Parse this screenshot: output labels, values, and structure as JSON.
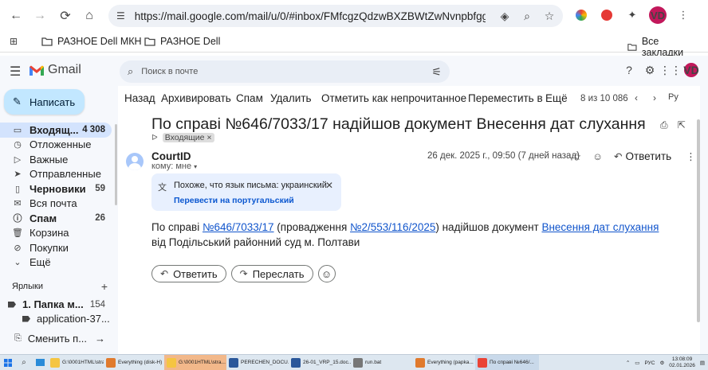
{
  "browser": {
    "url": "https://mail.google.com/mail/u/0/#inbox/FMfcgzQdzwBXZBWtZwNvnpbfggmxF...",
    "bookmarks": [
      "РАЗНОЕ Dell МКН",
      "РАЗНОЕ Dell"
    ],
    "all_bookmarks": "Все закладки",
    "profile_initials": "VD"
  },
  "gmail": {
    "logo_text": "Gmail",
    "search_placeholder": "Поиск в почте",
    "compose_label": "Написать",
    "nav": [
      {
        "label": "Входящ...",
        "count": "4 308",
        "icon": "inbox-icon"
      },
      {
        "label": "Отложенные",
        "count": "",
        "icon": "clock-icon"
      },
      {
        "label": "Важные",
        "count": "",
        "icon": "important-icon"
      },
      {
        "label": "Отправленные",
        "count": "",
        "icon": "send-icon"
      },
      {
        "label": "Черновики",
        "count": "59",
        "icon": "draft-icon"
      },
      {
        "label": "Вся почта",
        "count": "",
        "icon": "mail-icon"
      },
      {
        "label": "Спам",
        "count": "26",
        "icon": "spam-icon"
      },
      {
        "label": "Корзина",
        "count": "",
        "icon": "trash-icon"
      },
      {
        "label": "Покупки",
        "count": "",
        "icon": "shopping-icon"
      },
      {
        "label": "Ещё",
        "count": "",
        "icon": "chevron-down-icon"
      }
    ],
    "labels_header": "Ярлыки",
    "labels": [
      {
        "label": "1. Папка м...",
        "count": "154"
      },
      {
        "label": "application-37...",
        "count": ""
      }
    ],
    "switch_account": "Сменить п..."
  },
  "toolbar": {
    "back": "Назад",
    "archive": "Архивировать",
    "spam": "Спам",
    "delete": "Удалить",
    "mark_unread": "Отметить как непрочитанное",
    "move_to": "Переместить в",
    "more": "Ещё",
    "pager": "8 из 10 086",
    "lang": "Ру"
  },
  "message": {
    "subject": "По справі №646/7033/17 надійшов документ Внесення дат слухання",
    "inbox_chip": "Входящие",
    "sender": "CourtID",
    "recipient": "кому: мне",
    "date": "26 дек. 2025 г., 09:50 (7 дней назад)",
    "reply_label": "Ответить",
    "translate_notice": "Похоже, что язык письма: украинский",
    "translate_link": "Перевести на португальский",
    "body": {
      "p1": "По справі ",
      "link1": "№646/7033/17",
      "p2": " (провадження ",
      "link2": "№2/553/116/2025",
      "p3": ") надійшов документ ",
      "link3": "Внесення дат слухання",
      "p4": " від Подільський районний суд м. Полтави"
    },
    "reply_button": "Ответить",
    "forward_button": "Переслать"
  },
  "taskbar": {
    "items": [
      {
        "label": "G:\\0001HTML\\stra...",
        "color": "#f5c542"
      },
      {
        "label": "Everything (disk-H)",
        "color": "#e07a2d"
      },
      {
        "label": "G:\\0001HTML\\stra...",
        "color": "#f5c542"
      },
      {
        "label": "PERECHEN_DOCU...",
        "color": "#2b579a"
      },
      {
        "label": "26-01_VRP_15.doc...",
        "color": "#2b579a"
      },
      {
        "label": "run.bat",
        "color": "#777777"
      },
      {
        "label": "Everything (papka...",
        "color": "#e07a2d"
      },
      {
        "label": "По справі №646/...",
        "color": "#ea4335"
      }
    ],
    "lang": "РУС",
    "time": "13:08:09",
    "date": "02.01.2026"
  }
}
